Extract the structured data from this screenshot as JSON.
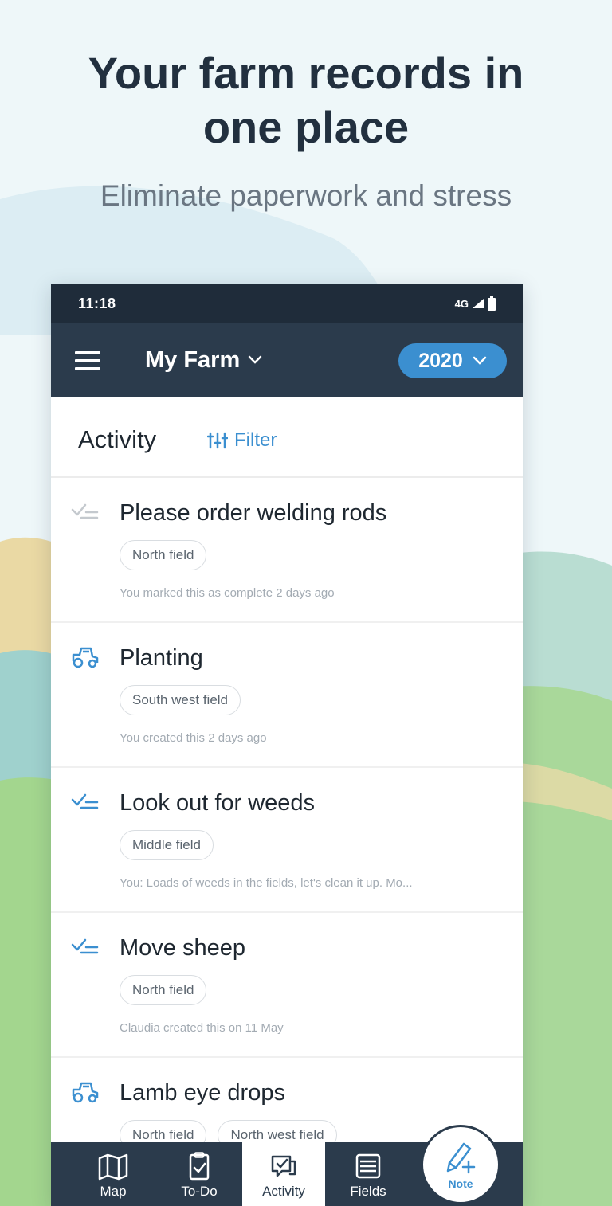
{
  "promo": {
    "headline_line1": "Your farm records in",
    "headline_line2": "one place",
    "subheadline": "Eliminate paperwork and stress"
  },
  "status_bar": {
    "time": "11:18",
    "network": "4G"
  },
  "app_bar": {
    "farm_name": "My Farm",
    "year": "2020"
  },
  "activity": {
    "title": "Activity",
    "filter_label": "Filter"
  },
  "items": [
    {
      "icon": "checklist-icon",
      "done": true,
      "title": "Please order welding rods",
      "tags": [
        "North field"
      ],
      "meta": "You marked this as complete 2 days ago"
    },
    {
      "icon": "tractor-icon",
      "title": "Planting",
      "tags": [
        "South west field"
      ],
      "meta": "You created this 2 days ago"
    },
    {
      "icon": "checklist-icon",
      "title": "Look out for weeds",
      "tags": [
        "Middle field"
      ],
      "meta": "You: Loads of weeds in the fields, let's clean it up. Mo..."
    },
    {
      "icon": "checklist-icon",
      "title": "Move sheep",
      "tags": [
        "North field"
      ],
      "meta": "Claudia created this on 11 May"
    },
    {
      "icon": "tractor-icon",
      "title": "Lamb eye drops",
      "tags": [
        "North field",
        "North west field"
      ],
      "meta": ""
    }
  ],
  "bottom_nav": [
    {
      "label": "Map",
      "icon": "map-icon"
    },
    {
      "label": "To-Do",
      "icon": "clipboard-check-icon"
    },
    {
      "label": "Activity",
      "icon": "activity-icon",
      "active": true
    },
    {
      "label": "Fields",
      "icon": "fields-icon"
    }
  ],
  "fab": {
    "label": "Note",
    "icon": "pen-plus-icon"
  },
  "colors": {
    "header": "#2b3b4c",
    "status_bar": "#1f2c3a",
    "accent": "#3b8fd0",
    "text_dark": "#22303f"
  }
}
